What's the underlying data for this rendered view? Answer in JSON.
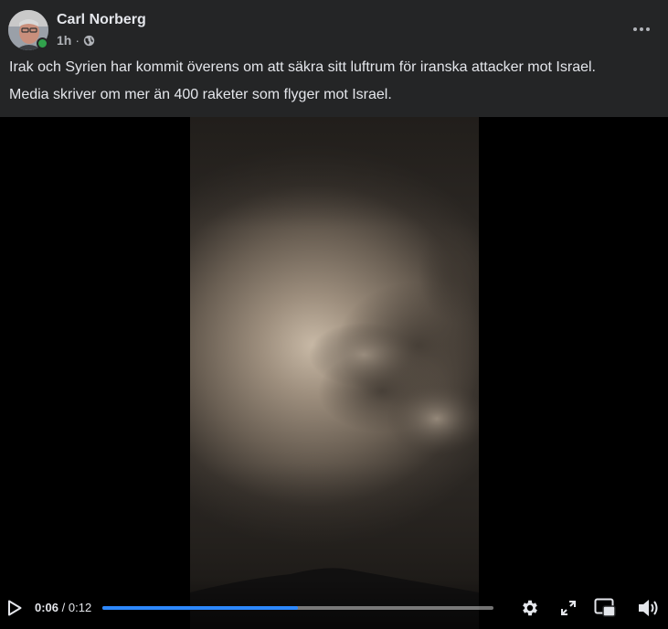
{
  "post": {
    "author": "Carl Norberg",
    "time": "1h",
    "separator": "·",
    "audience_icon": "globe-icon",
    "paragraphs": [
      "Irak och Syrien har kommit överens om att säkra sitt luftrum för iranska attacker mot Israel.",
      "Media skriver om mer än 400 raketer som flyger mot Israel."
    ]
  },
  "video": {
    "current_time": "0:06",
    "time_separator": " / ",
    "duration": "0:12",
    "progress_fraction": 0.5,
    "progress_color": "#2d88ff"
  },
  "icons": {
    "more": "more-options-icon",
    "play": "play-icon",
    "settings": "gear-icon",
    "fullscreen": "expand-icon",
    "pip": "picture-in-picture-icon",
    "volume": "volume-icon"
  },
  "colors": {
    "background": "#242526",
    "text": "#e4e6eb",
    "secondary_text": "#b0b3b8",
    "online": "#31a24c"
  }
}
